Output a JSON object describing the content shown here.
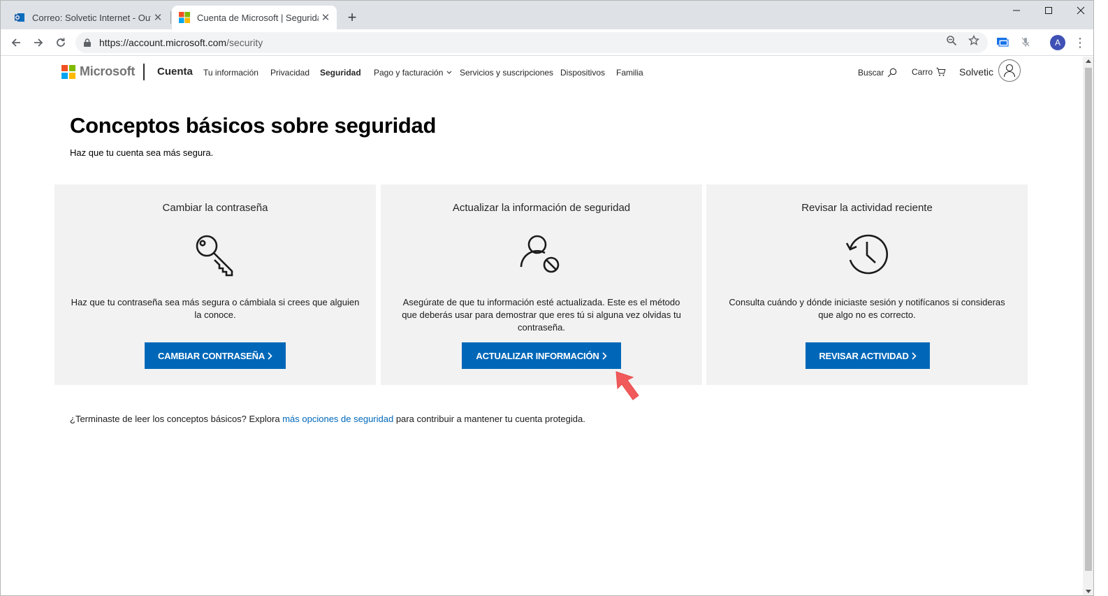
{
  "browser": {
    "tabs": [
      {
        "title": "Correo: Solvetic Internet - Outloo",
        "close": "✕",
        "active": false
      },
      {
        "title": "Cuenta de Microsoft | Seguridad",
        "close": "✕",
        "active": true
      }
    ],
    "new_tab": "+",
    "url_host": "https://account.microsoft.com",
    "url_path": "/security",
    "profile_initial": "A",
    "menu": "⋮"
  },
  "header": {
    "brand": "Microsoft",
    "section": "Cuenta",
    "nav": [
      "Tu información",
      "Privacidad",
      "Seguridad",
      "Pago y facturación",
      "Servicios y suscripciones",
      "Dispositivos",
      "Familia"
    ],
    "search_label": "Buscar",
    "cart_label": "Carro",
    "user_name": "Solvetic"
  },
  "page": {
    "title": "Conceptos básicos sobre seguridad",
    "subtitle": "Haz que tu cuenta sea más segura."
  },
  "cards": [
    {
      "title": "Cambiar la contraseña",
      "icon": "key-icon",
      "description": "Haz que tu contraseña sea más segura o cámbiala si crees que alguien la conoce.",
      "button": "CAMBIAR CONTRASEÑA"
    },
    {
      "title": "Actualizar la información de seguridad",
      "icon": "user-blocked-icon",
      "description": "Asegúrate de que tu información esté actualizada. Este es el método que deberás usar para demostrar que eres tú si alguna vez olvidas tu contraseña.",
      "button": "ACTUALIZAR INFORMACIÓN"
    },
    {
      "title": "Revisar la actividad reciente",
      "icon": "history-clock-icon",
      "description": "Consulta cuándo y dónde iniciaste sesión y notifícanos si consideras que algo no es correcto.",
      "button": "REVISAR ACTIVIDAD"
    }
  ],
  "footer": {
    "before": "¿Terminaste de leer los conceptos básicos? Explora ",
    "link": "más opciones de seguridad",
    "after": " para contribuir a mantener tu cuenta protegida."
  },
  "colors": {
    "accent": "#0067b8",
    "card_bg": "#f2f2f2",
    "pointer": "#f05a5a"
  }
}
